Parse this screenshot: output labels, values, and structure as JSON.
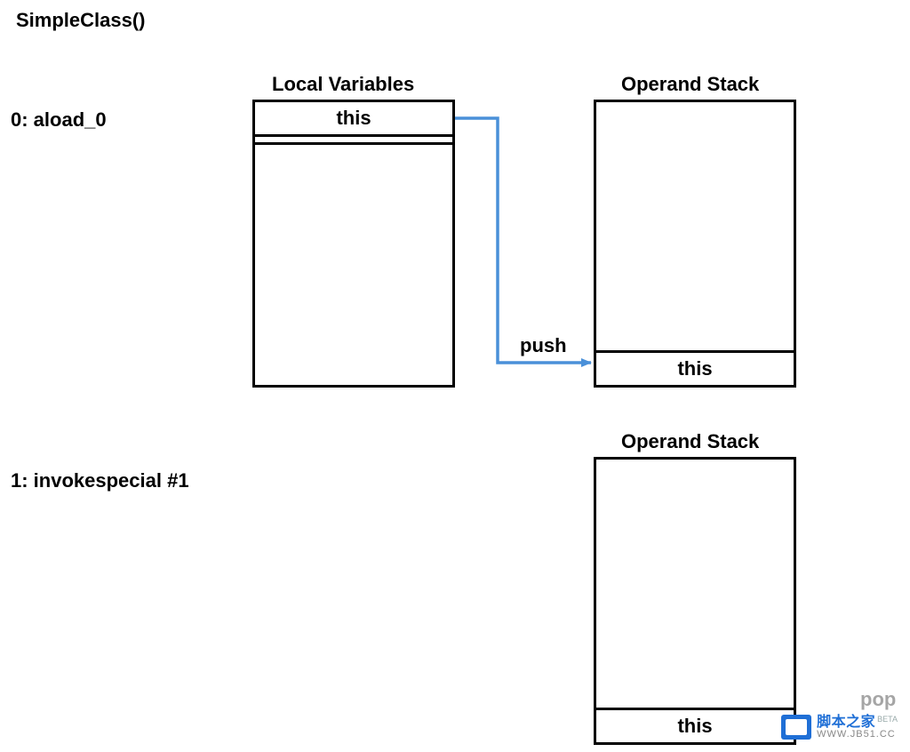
{
  "title": "SimpleClass()",
  "instructions": {
    "i0": "0: aload_0",
    "i1": "1: invokespecial #1"
  },
  "headings": {
    "localVars": "Local Variables",
    "opStack1": "Operand Stack",
    "opStack2": "Operand Stack"
  },
  "cells": {
    "localThis": "this",
    "stack1This": "this",
    "stack2This": "this"
  },
  "arrowLabel": "push",
  "partialLabel": "pop",
  "watermark": {
    "line1": "脚本之家",
    "line2": "WWW.JB51.CC",
    "beta": "BETA"
  },
  "colors": {
    "arrow": "#4a90d9"
  }
}
